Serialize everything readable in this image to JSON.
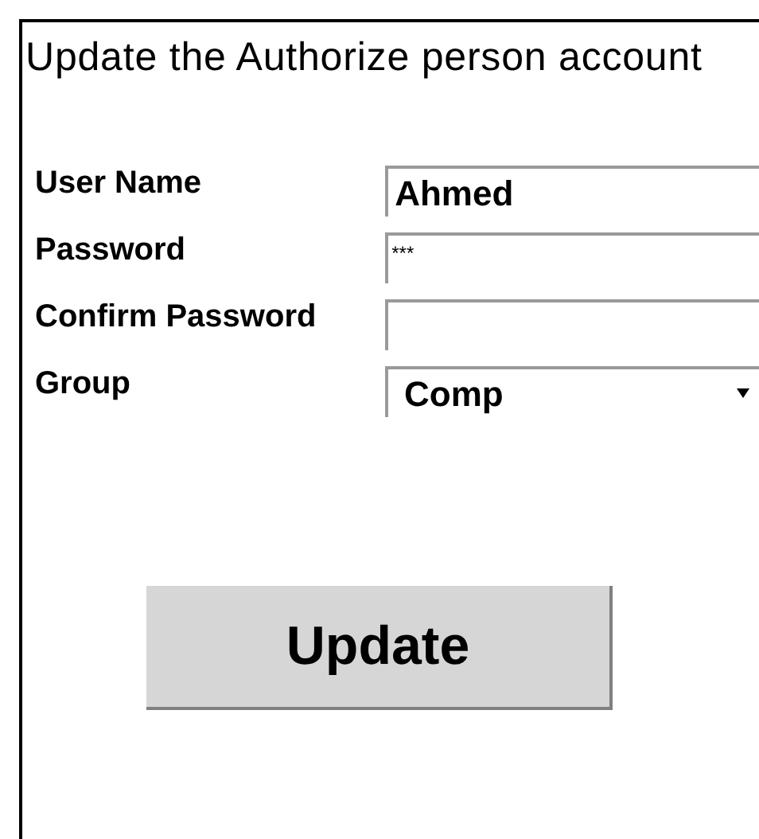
{
  "title": "Update the Authorize person account",
  "fields": [
    {
      "label": "User Name",
      "kind": "text",
      "value": "Ahmed"
    },
    {
      "label": "Password",
      "kind": "password",
      "value": "***"
    },
    {
      "label": "Confirm Password",
      "kind": "password"
    },
    {
      "label": "Group",
      "kind": "select",
      "value": "Comp"
    }
  ],
  "button": "Update"
}
